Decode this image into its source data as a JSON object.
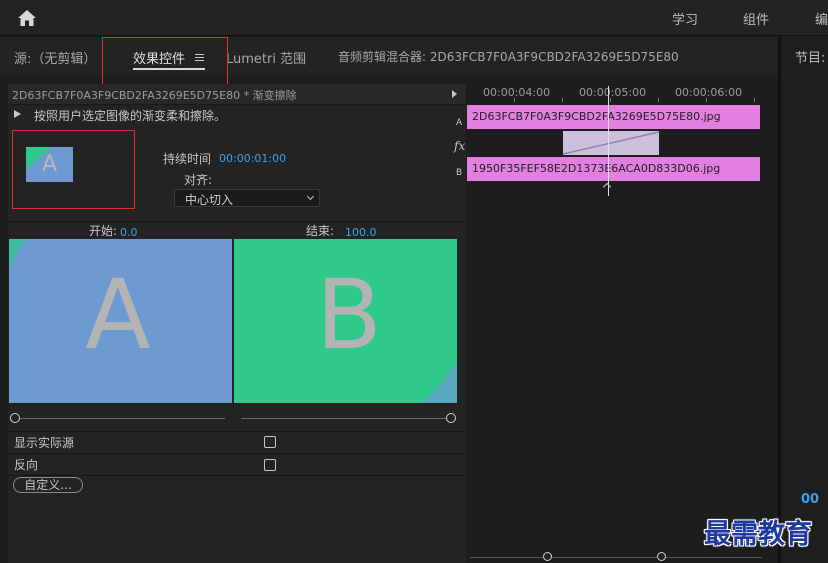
{
  "workspaces": [
    "学习",
    "组件",
    "编"
  ],
  "panel_tabs": [
    {
      "label": "源:（无剪辑）",
      "active": false
    },
    {
      "label": "效果控件",
      "active": true
    },
    {
      "label": "Lumetri 范围",
      "active": false
    },
    {
      "label": "音频剪辑混合器: 2D63FCB7F0A3F9CBD2FA3269E5D75E80",
      "active": false
    }
  ],
  "program_tab": "节目: ",
  "clip_header": "2D63FCB7F0A3F9CBD2FA3269E5D75E80 * 渐变擦除",
  "description": "按照用户选定图像的渐变柔和擦除。",
  "thumb_letter": "A",
  "duration": {
    "label": "持续时间",
    "value": "00:00:01:00"
  },
  "align": {
    "label": "对齐:",
    "selected": "中心切入"
  },
  "start": {
    "label": "开始:",
    "value": "0.0"
  },
  "end": {
    "label": "结束:",
    "value": "100.0"
  },
  "preview_a_letter": "A",
  "preview_b_letter": "B",
  "options": {
    "show_actual": "显示实际源",
    "reverse": "反向",
    "custom_button": "自定义..."
  },
  "timeline": {
    "timecodes": [
      "00:00:04:00",
      "00:00:05:00",
      "00:00:06:00"
    ],
    "clip_a": "2D63FCB7F0A3F9CBD2FA3269E5D75E80.jpg",
    "clip_b": "1950F35FEF58E2D1373E6ACA0D833D06.jpg",
    "track_a": "A",
    "track_b": "B",
    "fx": "fx"
  },
  "right_value": "00",
  "watermark": "最需教育",
  "colors": {
    "accent_blue": "#3ea0f0",
    "clip_pink": "#e27fe0",
    "preview_a": "#6e9ad2",
    "preview_b": "#2ec98b",
    "highlight_red": "#e03030"
  }
}
